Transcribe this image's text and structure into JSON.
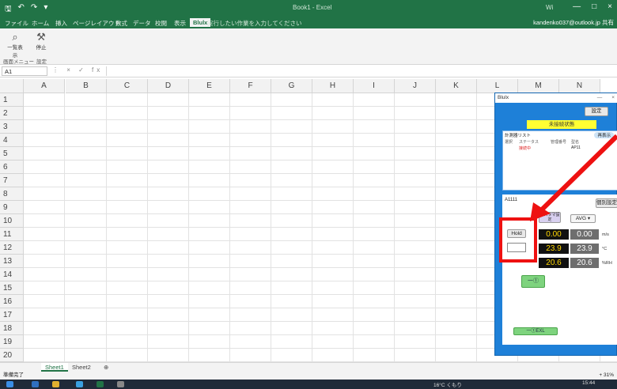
{
  "titlebar": {
    "qa_icons": [
      "save-icon",
      "undo-icon",
      "redo-icon",
      "customize-icon"
    ],
    "title": "Book1 - Excel",
    "user_short": "Wi",
    "controls": [
      "—",
      "□",
      "×"
    ]
  },
  "tabs": {
    "items": [
      "ファイル",
      "ホーム",
      "挿入",
      "ページレイアウト",
      "数式",
      "データ",
      "校閲",
      "表示",
      "Blulx"
    ],
    "active": "Blulx",
    "tell_me": "実行したい作業を入力してください",
    "account": "kandenko037@outlook.jp",
    "share": "共有"
  },
  "ribbon": {
    "btn1_label": "一覧表示",
    "btn2_label": "停止",
    "group1": "画面メニュー",
    "group2": "設定"
  },
  "formula_bar": {
    "name_box": "A1",
    "fx": "fx",
    "value": ""
  },
  "grid": {
    "columns": [
      "A",
      "B",
      "C",
      "D",
      "E",
      "F",
      "G",
      "H",
      "I",
      "J",
      "K",
      "L",
      "M",
      "N"
    ],
    "rows": [
      "1",
      "2",
      "3",
      "4",
      "5",
      "6",
      "7",
      "8",
      "9",
      "10",
      "11",
      "12",
      "13",
      "14",
      "15",
      "16",
      "17",
      "18",
      "19",
      "20"
    ]
  },
  "sheets": {
    "tabs": [
      "Sheet1",
      "Sheet2"
    ],
    "active": "Sheet1",
    "add": "⊕"
  },
  "status": {
    "left": "準備完了",
    "zoom": "+ 31%"
  },
  "taskbar": {
    "weather": "16°C くもり",
    "time": "15:44"
  },
  "dialog": {
    "title": "Blulx",
    "settings_btn": "設定",
    "yellow_btn": "未接続状態",
    "list_header": "計測器リスト",
    "list_btn": "再表示",
    "columns": [
      "選択",
      "ステータス",
      "管理番号",
      "型名"
    ],
    "row": {
      "status": "接続中",
      "code": "AP11"
    },
    "device": "A1111",
    "reset_btn": "個別設定",
    "avg_label": "AVG",
    "hold_btn": "Hold",
    "sub_btn": "カスタマ設定",
    "readings": [
      {
        "value": "0.00",
        "avg": "0.00",
        "unit": "m/s"
      },
      {
        "value": "23.9",
        "avg": "23.9",
        "unit": "°C"
      },
      {
        "value": "20.6",
        "avg": "20.6",
        "unit": "%RH"
      }
    ],
    "record_btn": "一①",
    "excel_btn": "一①EXL"
  },
  "colors": {
    "excel_green": "#217346",
    "dialog_blue": "#1e80d8",
    "highlight_red": "#ee1111"
  }
}
